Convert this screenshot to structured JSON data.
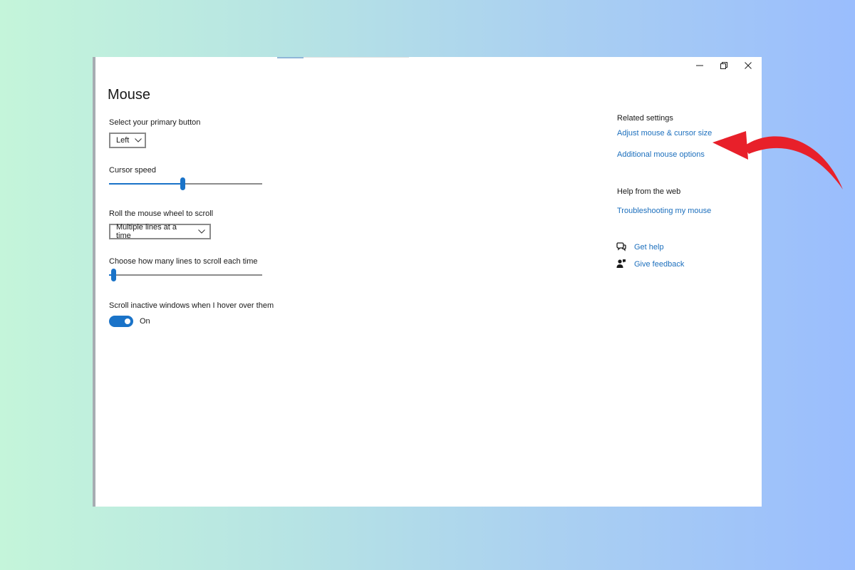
{
  "page": {
    "title": "Mouse",
    "background_gradient": [
      "#c4f5da",
      "#9abdfd"
    ],
    "accent_color": "#1a73c8",
    "link_color": "#1c6fbd"
  },
  "window_controls": {
    "minimize_icon": "minimize-icon",
    "restore_icon": "restore-icon",
    "close_icon": "close-icon"
  },
  "settings": {
    "primary_button": {
      "label": "Select your primary button",
      "value": "Left"
    },
    "cursor_speed": {
      "label": "Cursor speed",
      "level_fraction": 0.48
    },
    "wheel_scroll": {
      "label": "Roll the mouse wheel to scroll",
      "value": "Multiple lines at a time"
    },
    "lines_to_scroll": {
      "label": "Choose how many lines to scroll each time",
      "level_fraction": 0.03
    },
    "scroll_inactive": {
      "label": "Scroll inactive windows when I hover over them",
      "state": "On"
    }
  },
  "related_settings": {
    "heading": "Related settings",
    "links": [
      "Adjust mouse & cursor size",
      "Additional mouse options"
    ]
  },
  "help_from_web": {
    "heading": "Help from the web",
    "links": [
      "Troubleshooting my mouse"
    ]
  },
  "support": {
    "get_help": "Get help",
    "give_feedback": "Give feedback"
  },
  "annotation": {
    "arrow_color": "#e8202a",
    "points_to": "Additional mouse options"
  }
}
